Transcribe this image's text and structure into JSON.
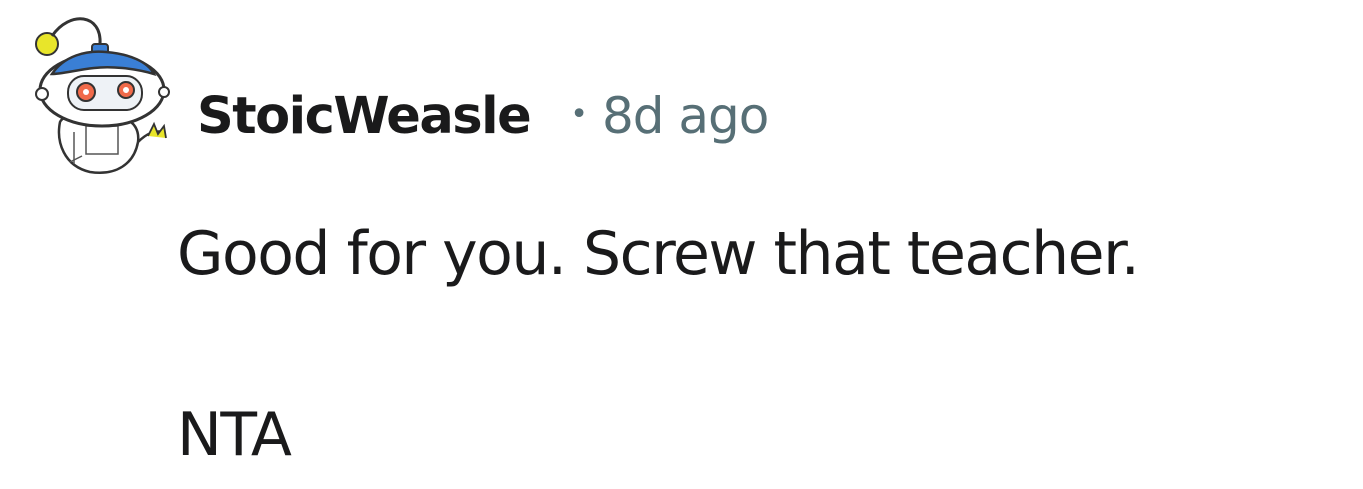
{
  "comment": {
    "author": "StoicWeasle",
    "separator": "•",
    "timestamp": "8d ago",
    "avatar_icon": "snoo-robot-avatar-icon",
    "body_lines": [
      "Good for you. Screw that teacher.",
      "NTA"
    ]
  },
  "colors": {
    "text_primary": "#1a1a1b",
    "text_secondary": "#576f76",
    "avatar_blue": "#3a7fd5",
    "avatar_eye": "#f06a4a",
    "avatar_bulb": "#e8e52a"
  }
}
